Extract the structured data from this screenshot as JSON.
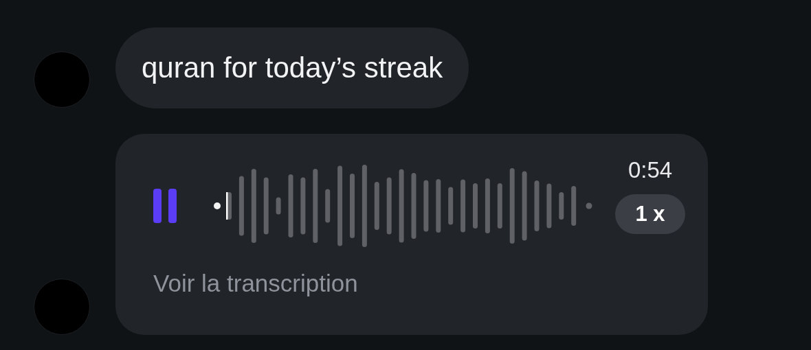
{
  "messages": [
    {
      "kind": "text",
      "text": "quran for today’s streak"
    },
    {
      "kind": "voice",
      "playing": true,
      "duration": "0:54",
      "speed": "1 x",
      "transcript_link": "Voir la transcription"
    }
  ]
}
